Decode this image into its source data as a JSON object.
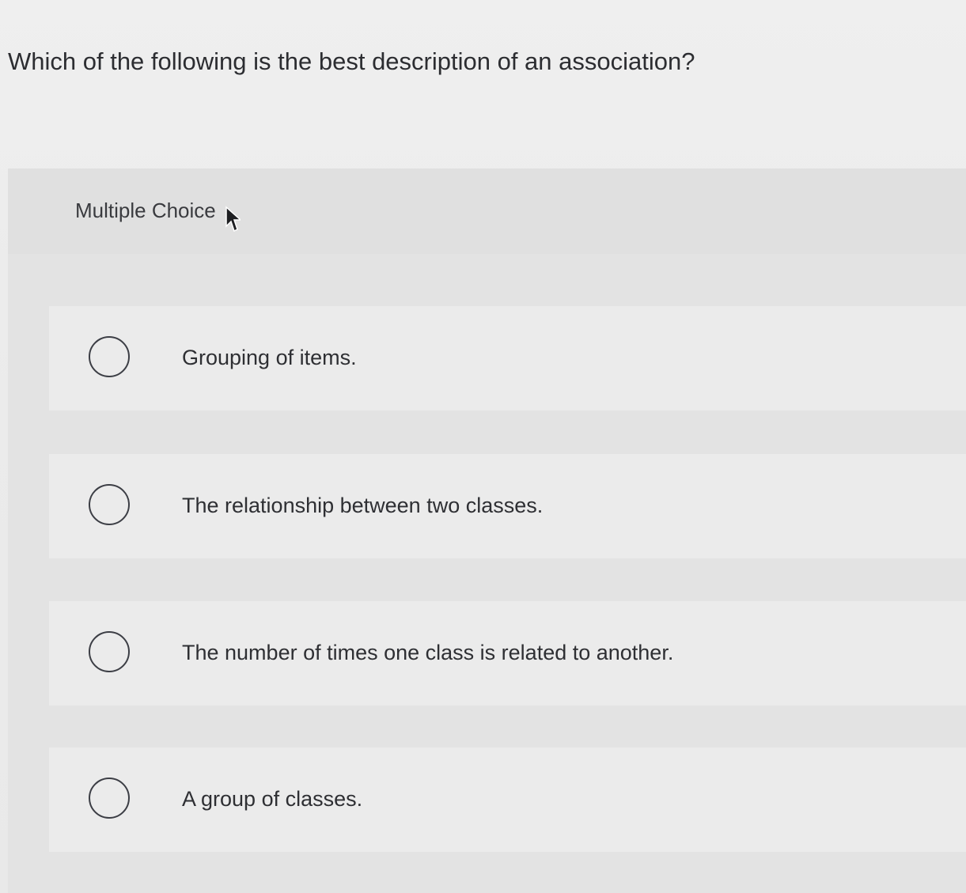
{
  "question": {
    "text": "Which of the following is the best description of an association?"
  },
  "section": {
    "label": "Multiple Choice"
  },
  "options": [
    {
      "label": "Grouping of items."
    },
    {
      "label": "The relationship between two classes."
    },
    {
      "label": "The number of times one class is related to another."
    },
    {
      "label": "A group of classes."
    }
  ],
  "icons": {
    "pointer": "mouse-pointer-icon",
    "radio": "radio-button-unselected"
  },
  "colors": {
    "text": "#2e2f33",
    "radio_border": "#3c3e45",
    "background": "#ededed",
    "panel": "#e3e3e3"
  }
}
